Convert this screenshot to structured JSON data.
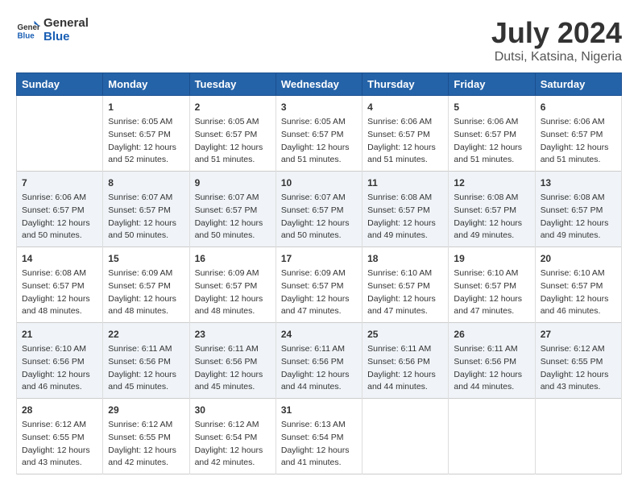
{
  "logo": {
    "line1": "General",
    "line2": "Blue"
  },
  "title": "July 2024",
  "location": "Dutsi, Katsina, Nigeria",
  "weekdays": [
    "Sunday",
    "Monday",
    "Tuesday",
    "Wednesday",
    "Thursday",
    "Friday",
    "Saturday"
  ],
  "weeks": [
    [
      {
        "day": "",
        "content": ""
      },
      {
        "day": "1",
        "content": "Sunrise: 6:05 AM\nSunset: 6:57 PM\nDaylight: 12 hours\nand 52 minutes."
      },
      {
        "day": "2",
        "content": "Sunrise: 6:05 AM\nSunset: 6:57 PM\nDaylight: 12 hours\nand 51 minutes."
      },
      {
        "day": "3",
        "content": "Sunrise: 6:05 AM\nSunset: 6:57 PM\nDaylight: 12 hours\nand 51 minutes."
      },
      {
        "day": "4",
        "content": "Sunrise: 6:06 AM\nSunset: 6:57 PM\nDaylight: 12 hours\nand 51 minutes."
      },
      {
        "day": "5",
        "content": "Sunrise: 6:06 AM\nSunset: 6:57 PM\nDaylight: 12 hours\nand 51 minutes."
      },
      {
        "day": "6",
        "content": "Sunrise: 6:06 AM\nSunset: 6:57 PM\nDaylight: 12 hours\nand 51 minutes."
      }
    ],
    [
      {
        "day": "7",
        "content": "Sunrise: 6:06 AM\nSunset: 6:57 PM\nDaylight: 12 hours\nand 50 minutes."
      },
      {
        "day": "8",
        "content": "Sunrise: 6:07 AM\nSunset: 6:57 PM\nDaylight: 12 hours\nand 50 minutes."
      },
      {
        "day": "9",
        "content": "Sunrise: 6:07 AM\nSunset: 6:57 PM\nDaylight: 12 hours\nand 50 minutes."
      },
      {
        "day": "10",
        "content": "Sunrise: 6:07 AM\nSunset: 6:57 PM\nDaylight: 12 hours\nand 50 minutes."
      },
      {
        "day": "11",
        "content": "Sunrise: 6:08 AM\nSunset: 6:57 PM\nDaylight: 12 hours\nand 49 minutes."
      },
      {
        "day": "12",
        "content": "Sunrise: 6:08 AM\nSunset: 6:57 PM\nDaylight: 12 hours\nand 49 minutes."
      },
      {
        "day": "13",
        "content": "Sunrise: 6:08 AM\nSunset: 6:57 PM\nDaylight: 12 hours\nand 49 minutes."
      }
    ],
    [
      {
        "day": "14",
        "content": "Sunrise: 6:08 AM\nSunset: 6:57 PM\nDaylight: 12 hours\nand 48 minutes."
      },
      {
        "day": "15",
        "content": "Sunrise: 6:09 AM\nSunset: 6:57 PM\nDaylight: 12 hours\nand 48 minutes."
      },
      {
        "day": "16",
        "content": "Sunrise: 6:09 AM\nSunset: 6:57 PM\nDaylight: 12 hours\nand 48 minutes."
      },
      {
        "day": "17",
        "content": "Sunrise: 6:09 AM\nSunset: 6:57 PM\nDaylight: 12 hours\nand 47 minutes."
      },
      {
        "day": "18",
        "content": "Sunrise: 6:10 AM\nSunset: 6:57 PM\nDaylight: 12 hours\nand 47 minutes."
      },
      {
        "day": "19",
        "content": "Sunrise: 6:10 AM\nSunset: 6:57 PM\nDaylight: 12 hours\nand 47 minutes."
      },
      {
        "day": "20",
        "content": "Sunrise: 6:10 AM\nSunset: 6:57 PM\nDaylight: 12 hours\nand 46 minutes."
      }
    ],
    [
      {
        "day": "21",
        "content": "Sunrise: 6:10 AM\nSunset: 6:56 PM\nDaylight: 12 hours\nand 46 minutes."
      },
      {
        "day": "22",
        "content": "Sunrise: 6:11 AM\nSunset: 6:56 PM\nDaylight: 12 hours\nand 45 minutes."
      },
      {
        "day": "23",
        "content": "Sunrise: 6:11 AM\nSunset: 6:56 PM\nDaylight: 12 hours\nand 45 minutes."
      },
      {
        "day": "24",
        "content": "Sunrise: 6:11 AM\nSunset: 6:56 PM\nDaylight: 12 hours\nand 44 minutes."
      },
      {
        "day": "25",
        "content": "Sunrise: 6:11 AM\nSunset: 6:56 PM\nDaylight: 12 hours\nand 44 minutes."
      },
      {
        "day": "26",
        "content": "Sunrise: 6:11 AM\nSunset: 6:56 PM\nDaylight: 12 hours\nand 44 minutes."
      },
      {
        "day": "27",
        "content": "Sunrise: 6:12 AM\nSunset: 6:55 PM\nDaylight: 12 hours\nand 43 minutes."
      }
    ],
    [
      {
        "day": "28",
        "content": "Sunrise: 6:12 AM\nSunset: 6:55 PM\nDaylight: 12 hours\nand 43 minutes."
      },
      {
        "day": "29",
        "content": "Sunrise: 6:12 AM\nSunset: 6:55 PM\nDaylight: 12 hours\nand 42 minutes."
      },
      {
        "day": "30",
        "content": "Sunrise: 6:12 AM\nSunset: 6:54 PM\nDaylight: 12 hours\nand 42 minutes."
      },
      {
        "day": "31",
        "content": "Sunrise: 6:13 AM\nSunset: 6:54 PM\nDaylight: 12 hours\nand 41 minutes."
      },
      {
        "day": "",
        "content": ""
      },
      {
        "day": "",
        "content": ""
      },
      {
        "day": "",
        "content": ""
      }
    ]
  ]
}
